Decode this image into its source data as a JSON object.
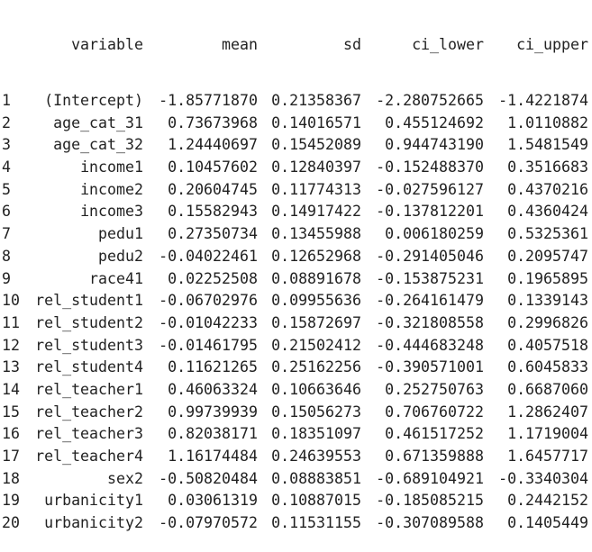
{
  "table": {
    "headers": {
      "variable": "variable",
      "mean": "mean",
      "sd": "sd",
      "ci_lower": "ci_lower",
      "ci_upper": "ci_upper"
    },
    "rows": [
      {
        "idx": "1",
        "variable": "(Intercept)",
        "mean": "-1.85771870",
        "sd": "0.21358367",
        "ci_lower": "-2.280752665",
        "ci_upper": "-1.4221874"
      },
      {
        "idx": "2",
        "variable": "age_cat_31",
        "mean": "0.73673968",
        "sd": "0.14016571",
        "ci_lower": "0.455124692",
        "ci_upper": "1.0110882"
      },
      {
        "idx": "3",
        "variable": "age_cat_32",
        "mean": "1.24440697",
        "sd": "0.15452089",
        "ci_lower": "0.944743190",
        "ci_upper": "1.5481549"
      },
      {
        "idx": "4",
        "variable": "income1",
        "mean": "0.10457602",
        "sd": "0.12840397",
        "ci_lower": "-0.152488370",
        "ci_upper": "0.3516683"
      },
      {
        "idx": "5",
        "variable": "income2",
        "mean": "0.20604745",
        "sd": "0.11774313",
        "ci_lower": "-0.027596127",
        "ci_upper": "0.4370216"
      },
      {
        "idx": "6",
        "variable": "income3",
        "mean": "0.15582943",
        "sd": "0.14917422",
        "ci_lower": "-0.137812201",
        "ci_upper": "0.4360424"
      },
      {
        "idx": "7",
        "variable": "pedu1",
        "mean": "0.27350734",
        "sd": "0.13455988",
        "ci_lower": "0.006180259",
        "ci_upper": "0.5325361"
      },
      {
        "idx": "8",
        "variable": "pedu2",
        "mean": "-0.04022461",
        "sd": "0.12652968",
        "ci_lower": "-0.291405046",
        "ci_upper": "0.2095747"
      },
      {
        "idx": "9",
        "variable": "race41",
        "mean": "0.02252508",
        "sd": "0.08891678",
        "ci_lower": "-0.153875231",
        "ci_upper": "0.1965895"
      },
      {
        "idx": "10",
        "variable": "rel_student1",
        "mean": "-0.06702976",
        "sd": "0.09955636",
        "ci_lower": "-0.264161479",
        "ci_upper": "0.1339143"
      },
      {
        "idx": "11",
        "variable": "rel_student2",
        "mean": "-0.01042233",
        "sd": "0.15872697",
        "ci_lower": "-0.321808558",
        "ci_upper": "0.2996826"
      },
      {
        "idx": "12",
        "variable": "rel_student3",
        "mean": "-0.01461795",
        "sd": "0.21502412",
        "ci_lower": "-0.444683248",
        "ci_upper": "0.4057518"
      },
      {
        "idx": "13",
        "variable": "rel_student4",
        "mean": "0.11621265",
        "sd": "0.25162256",
        "ci_lower": "-0.390571001",
        "ci_upper": "0.6045833"
      },
      {
        "idx": "14",
        "variable": "rel_teacher1",
        "mean": "0.46063324",
        "sd": "0.10663646",
        "ci_lower": "0.252750763",
        "ci_upper": "0.6687060"
      },
      {
        "idx": "15",
        "variable": "rel_teacher2",
        "mean": "0.99739939",
        "sd": "0.15056273",
        "ci_lower": "0.706760722",
        "ci_upper": "1.2862407"
      },
      {
        "idx": "16",
        "variable": "rel_teacher3",
        "mean": "0.82038171",
        "sd": "0.18351097",
        "ci_lower": "0.461517252",
        "ci_upper": "1.1719004"
      },
      {
        "idx": "17",
        "variable": "rel_teacher4",
        "mean": "1.16174484",
        "sd": "0.24639553",
        "ci_lower": "0.671359888",
        "ci_upper": "1.6457717"
      },
      {
        "idx": "18",
        "variable": "sex2",
        "mean": "-0.50820484",
        "sd": "0.08883851",
        "ci_lower": "-0.689104921",
        "ci_upper": "-0.3340304"
      },
      {
        "idx": "19",
        "variable": "urbanicity1",
        "mean": "0.03061319",
        "sd": "0.10887015",
        "ci_lower": "-0.185085215",
        "ci_upper": "0.2442152"
      },
      {
        "idx": "20",
        "variable": "urbanicity2",
        "mean": "-0.07970572",
        "sd": "0.11531155",
        "ci_lower": "-0.307089588",
        "ci_upper": "0.1405449"
      }
    ]
  }
}
